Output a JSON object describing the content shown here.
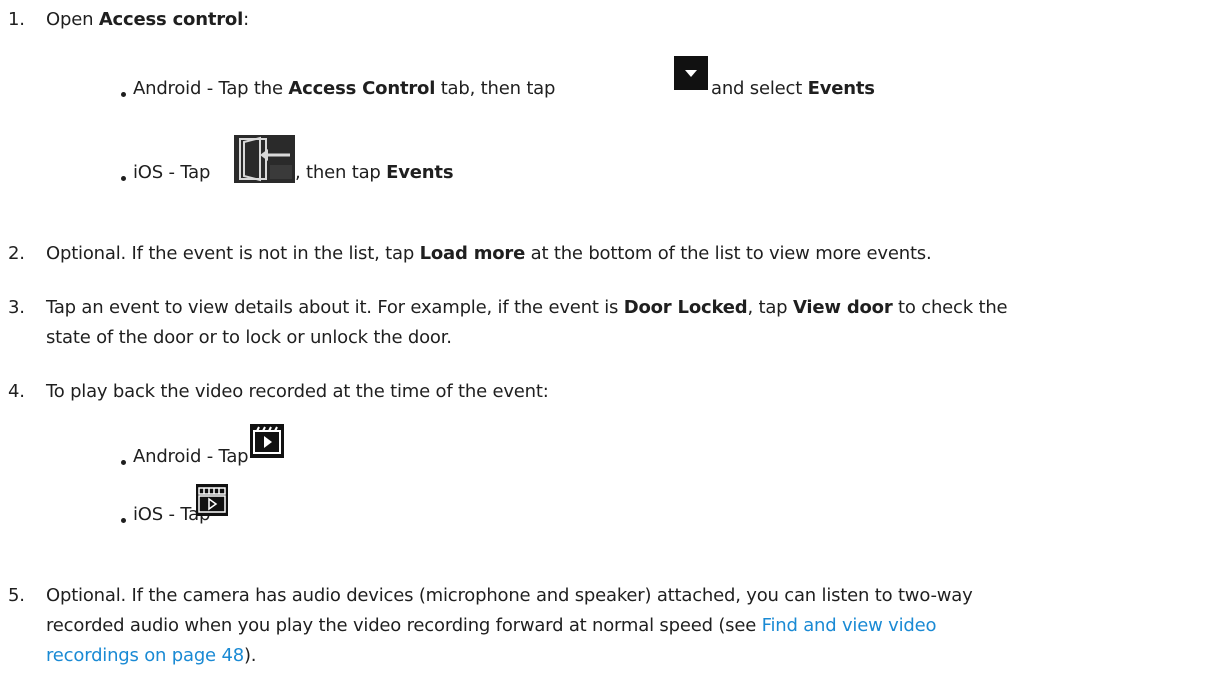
{
  "steps": [
    {
      "number": "1.",
      "pre": "Open ",
      "bold": "Access control",
      "post": ":"
    },
    {
      "number": "2.",
      "pre": "Optional. If the event is not in the list, tap ",
      "bold": "Load more",
      "post": " at the bottom of the list to view more events."
    },
    {
      "number": "3.",
      "line1_pre": "Tap an event to view details about it. For example, if the event is ",
      "line1_bold1": "Door Locked",
      "line1_mid": ", tap ",
      "line1_bold2": "View door",
      "line1_post": " to check the",
      "line2": "state of the door or to lock or unlock the door."
    },
    {
      "number": "4.",
      "text": "To play back the video recorded at the time of the event:"
    },
    {
      "number": "5.",
      "line1": "Optional. If the camera has audio devices (microphone and speaker) attached, you can listen to two-way",
      "line2_pre": "recorded audio when you play the video recording forward at normal speed (see ",
      "link_part1": "Find and view video",
      "link_part2": "recordings on page 48",
      "line3_post": ")."
    }
  ],
  "step1_sub": {
    "android_pre": "Android - Tap the ",
    "android_bold1": "Access Control",
    "android_mid": " tab, then tap ",
    "android_post": " and select ",
    "android_bold2": "Events",
    "ios_pre": "iOS - Tap ",
    "ios_mid": ", then tap ",
    "ios_bold": "Events"
  },
  "step4_sub": {
    "android": "Android - Tap ",
    "ios": "iOS - Tap "
  },
  "icons": {
    "dropdown": "dropdown-arrow-icon",
    "door": "door-exit-icon",
    "clapper_android": "video-playback-icon",
    "clapper_ios": "video-clip-icon"
  },
  "colors": {
    "text": "#1f1f1f",
    "link": "#1a8ad4",
    "icon_dark": "#111111"
  }
}
